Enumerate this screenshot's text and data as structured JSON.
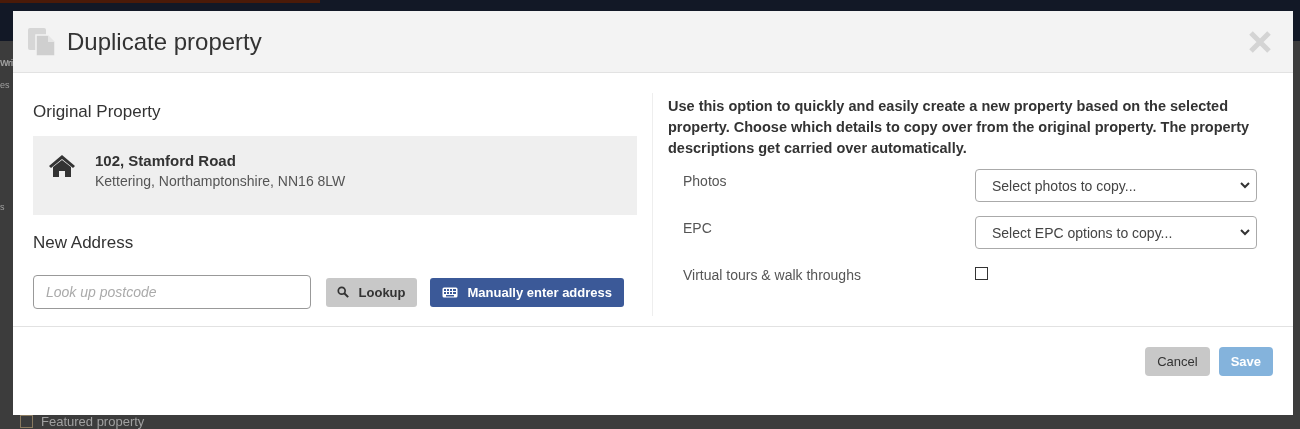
{
  "background_page": {
    "heading_fragment": "Wri",
    "subheading_fragment": "es",
    "side_fragment": "s",
    "featured_property": {
      "label": "Featured property",
      "checked": false
    }
  },
  "dialog": {
    "title": "Duplicate property",
    "original_property": {
      "heading": "Original Property",
      "address_line_1": "102, Stamford Road",
      "address_line_2": "Kettering, Northamptonshire, NN16 8LW"
    },
    "new_address": {
      "heading": "New Address",
      "postcode_field": {
        "placeholder": "Look up postcode"
      },
      "lookup_button": "Lookup",
      "manual_button": "Manually enter address"
    },
    "description": "Use this option to quickly and easily create a new property based on the selected property. Choose which details to copy over from the original property. The property descriptions get carried over automatically.",
    "options": [
      {
        "kind": "select",
        "label": "Photos",
        "placeholder": "Select photos to copy..."
      },
      {
        "kind": "select",
        "label": "EPC",
        "placeholder": "Select EPC options to copy..."
      },
      {
        "kind": "checkbox",
        "label": "Virtual tours & walk throughs",
        "checked": false
      }
    ],
    "buttons": [
      {
        "kind": "secondary",
        "label": "Cancel",
        "disabled": false
      },
      {
        "kind": "primary",
        "label": "Save",
        "disabled": true
      }
    ]
  }
}
